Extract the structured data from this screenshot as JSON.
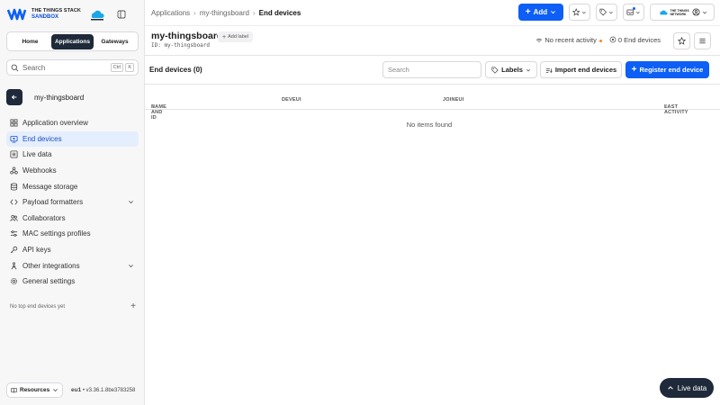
{
  "brand": {
    "line1": "THE THINGS STACK",
    "line2": "SANDBOX",
    "network_text": "THE THINGS NETWORK"
  },
  "sidebar": {
    "tabs": [
      {
        "label": "Home",
        "active": false
      },
      {
        "label": "Applications",
        "active": true
      },
      {
        "label": "Gateways",
        "active": false
      }
    ],
    "search": {
      "placeholder": "Search",
      "kbd1": "Ctrl",
      "kbd2": "K"
    },
    "app_name": "my-thingsboard",
    "menu": [
      {
        "label": "Application overview",
        "icon": "grid-icon"
      },
      {
        "label": "End devices",
        "icon": "devices-icon",
        "active": true
      },
      {
        "label": "Live data",
        "icon": "list-icon"
      },
      {
        "label": "Webhooks",
        "icon": "webhook-icon"
      },
      {
        "label": "Message storage",
        "icon": "database-icon"
      },
      {
        "label": "Payload formatters",
        "icon": "code-icon",
        "expandable": true
      },
      {
        "label": "Collaborators",
        "icon": "users-icon"
      },
      {
        "label": "MAC settings profiles",
        "icon": "sliders-icon"
      },
      {
        "label": "API keys",
        "icon": "key-icon"
      },
      {
        "label": "Other integrations",
        "icon": "integrations-icon",
        "expandable": true
      },
      {
        "label": "General settings",
        "icon": "gear-icon"
      }
    ],
    "no_top": "No top end devices yet",
    "resources_label": "Resources",
    "cluster": "eu1",
    "version": " • v3.36.1.8be3783258"
  },
  "breadcrumb": [
    "Applications",
    "my-thingsboard",
    "End devices"
  ],
  "topbar": {
    "add_label": "Add"
  },
  "app": {
    "title": "my-thingsboard",
    "id": "ID: my-thingsboard",
    "add_label": "Add label",
    "activity": "No recent activity",
    "devices_count": "0 End devices"
  },
  "table": {
    "title": "End devices (0)",
    "search_placeholder": "Search",
    "labels_btn": "Labels",
    "import_btn": "Import end devices",
    "register_btn": "Register end device",
    "columns": [
      "NAME AND ID",
      "DEVEUI",
      "JOINEUI",
      "LAST ACTIVITY"
    ],
    "empty": "No items found"
  },
  "live_data": "Live data",
  "colors": {
    "primary": "#0d5ff5",
    "dark": "#1e2a3a",
    "accent_dot": "#f08a24"
  }
}
